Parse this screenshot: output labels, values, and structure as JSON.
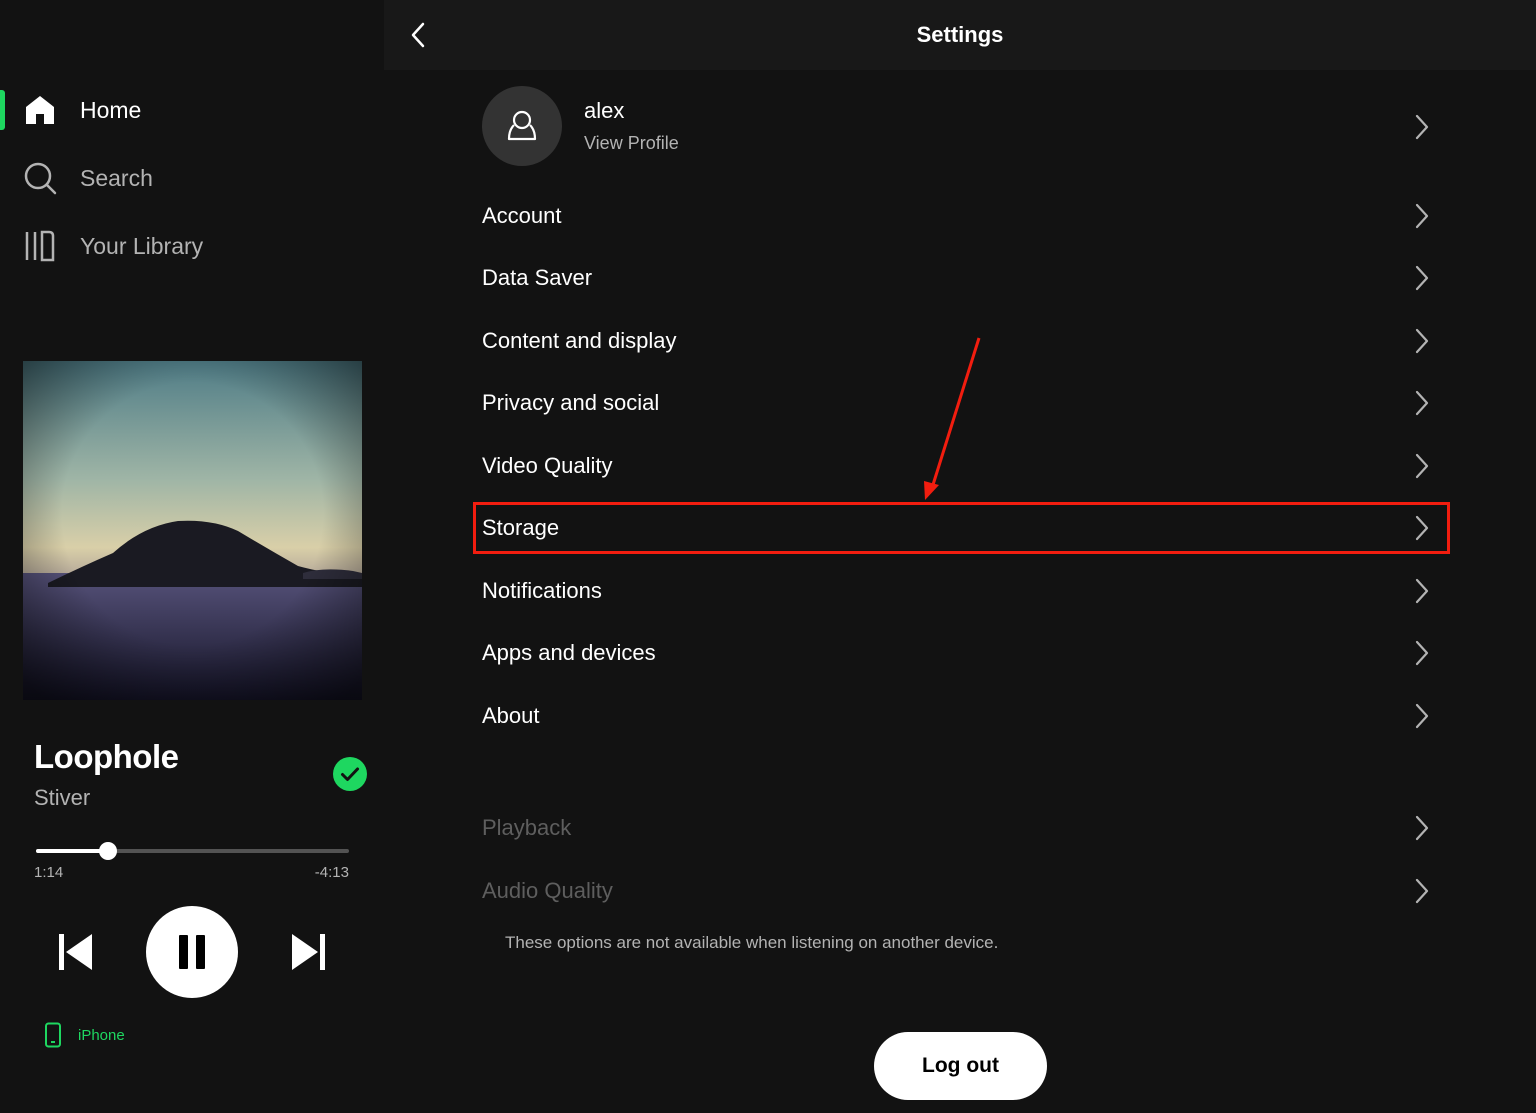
{
  "sidebar": {
    "nav": [
      {
        "label": "Home",
        "icon": "home-icon",
        "active": true
      },
      {
        "label": "Search",
        "icon": "search-icon",
        "active": false
      },
      {
        "label": "Your Library",
        "icon": "library-icon",
        "active": false
      }
    ],
    "accent_color": "#1ed760"
  },
  "now_playing": {
    "title": "Loophole",
    "artist": "Stiver",
    "liked": true,
    "elapsed": "1:14",
    "remaining": "-4:13",
    "progress": 0.23,
    "playing": true,
    "device": "iPhone"
  },
  "header": {
    "title": "Settings"
  },
  "profile": {
    "name": "alex",
    "subtitle": "View Profile"
  },
  "settings": [
    {
      "label": "Account",
      "enabled": true
    },
    {
      "label": "Data Saver",
      "enabled": true
    },
    {
      "label": "Content and display",
      "enabled": true
    },
    {
      "label": "Privacy and social",
      "enabled": true
    },
    {
      "label": "Video Quality",
      "enabled": true
    },
    {
      "label": "Storage",
      "enabled": true,
      "highlighted": true
    },
    {
      "label": "Notifications",
      "enabled": true
    },
    {
      "label": "Apps and devices",
      "enabled": true
    },
    {
      "label": "About",
      "enabled": true
    }
  ],
  "unavailable_settings": [
    {
      "label": "Playback",
      "enabled": false
    },
    {
      "label": "Audio Quality",
      "enabled": false
    }
  ],
  "unavailable_note": "These options are not available when listening on another device.",
  "logout_label": "Log out",
  "annotation_color": "#f21d0f"
}
